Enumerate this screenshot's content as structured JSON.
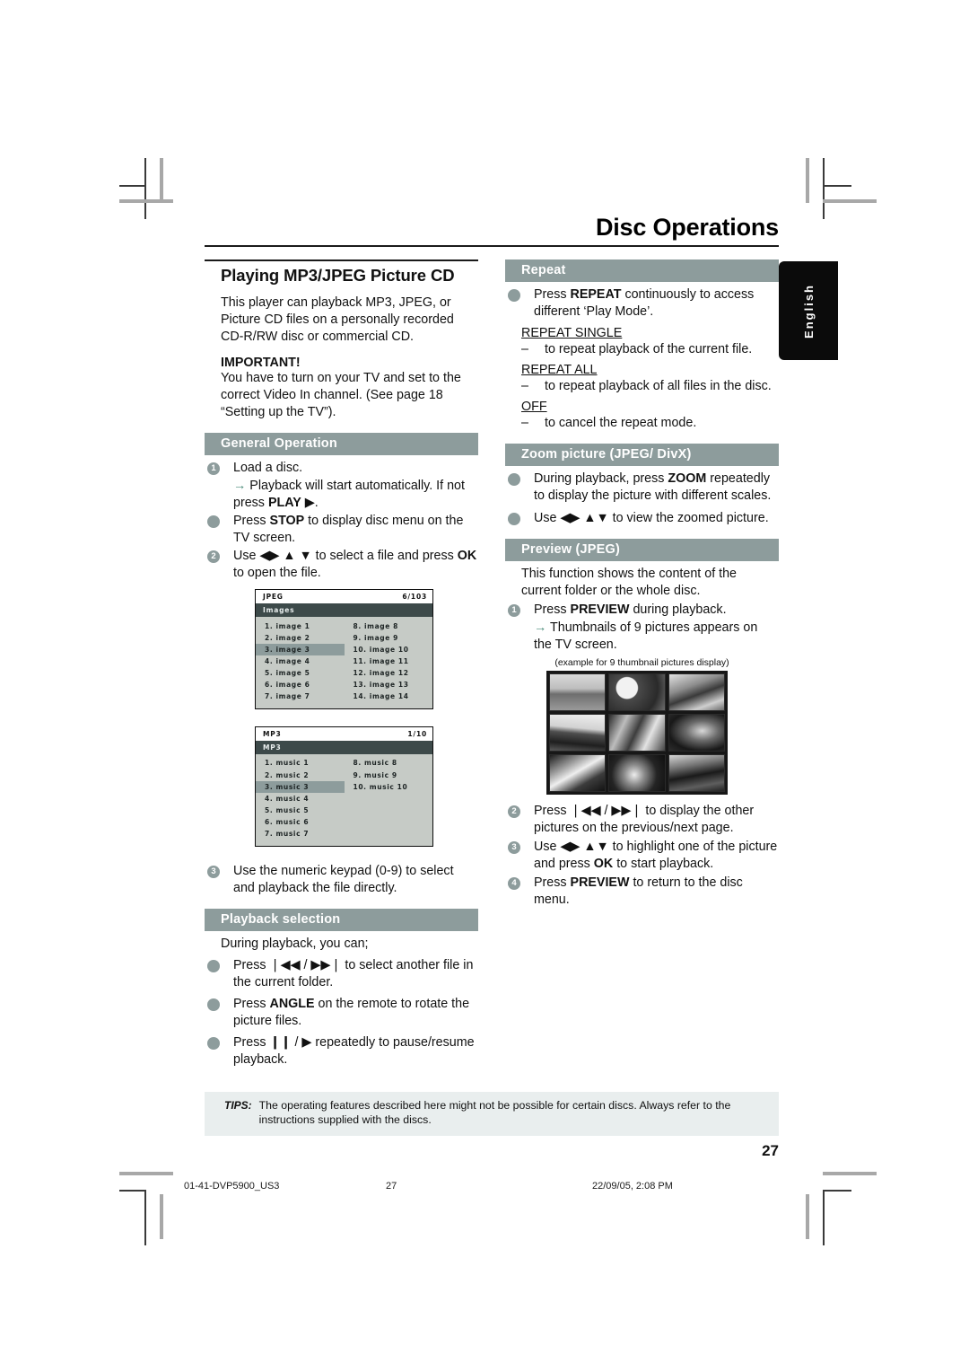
{
  "header": {
    "doc_title": "Disc Operations",
    "language_tab": "English"
  },
  "left_column": {
    "section_title": "Playing MP3/JPEG Picture CD",
    "intro": "This player can playback MP3, JPEG, or Picture CD files on a personally recorded CD-R/RW disc or commercial CD.",
    "important_label": "IMPORTANT!",
    "important_text": "You have to turn on your TV and set to the correct Video In channel.  (See page 18 “Setting up the TV”).",
    "general_operation": {
      "bar": "General Operation",
      "items": [
        {
          "marker": "1",
          "text": "Load a disc."
        },
        {
          "marker": "arrow",
          "text": "Playback will start automatically. If not press PLAY ▶."
        },
        {
          "marker": "dot",
          "text": "Press STOP to display disc menu on the TV screen."
        },
        {
          "marker": "2",
          "text": "Use ◀▶ ▲ ▼ to select a file and press OK to open the file."
        }
      ]
    },
    "jpeg_menu": {
      "type_label": "JPEG",
      "counter": "6/103",
      "folder": "Images",
      "col1": [
        "1. image 1",
        "2. image 2",
        "3. image 3",
        "4. image 4",
        "5. image 5",
        "6. image 6",
        "7. image 7"
      ],
      "col2": [
        "8. image 8",
        "9. image 9",
        "10. image 10",
        "11. image 11",
        "12. image 12",
        "13. image 13",
        "14. image 14"
      ],
      "highlighted": "3. image 3"
    },
    "mp3_menu": {
      "type_label": "MP3",
      "counter": "1/10",
      "folder": "MP3",
      "col1": [
        "1. music 1",
        "2. music 2",
        "3. music 3",
        "4. music 4",
        "5. music 5",
        "6. music 6",
        "7. music 7"
      ],
      "col2": [
        "8. music 8",
        "9. music 9",
        "10. music 10"
      ],
      "highlighted": "3. music 3"
    },
    "step3": {
      "marker": "3",
      "text": "Use the numeric keypad (0-9) to select and playback the file directly."
    },
    "playback_selection": {
      "bar": "Playback selection",
      "lead": "During playback, you can;",
      "items": [
        "Press ❘◀◀ / ▶▶❘ to select another file in the current folder.",
        "Press ANGLE on the remote to rotate the picture files.",
        "Press ❙❙ / ▶ repeatedly to pause/resume playback."
      ]
    }
  },
  "right_column": {
    "repeat": {
      "bar": "Repeat",
      "intro": "Press REPEAT continuously to access different ‘Play Mode’.",
      "modes": [
        {
          "name": "REPEAT SINGLE",
          "desc": "to repeat playback of the current file."
        },
        {
          "name": "REPEAT ALL",
          "desc": "to repeat playback of all files in the disc."
        },
        {
          "name": "OFF",
          "desc": "to cancel the repeat mode."
        }
      ]
    },
    "zoom_picture": {
      "bar": "Zoom picture (JPEG/ DivX)",
      "items": [
        "During playback, press ZOOM repeatedly to display the picture with different scales.",
        "Use ◀▶ ▲▼ to view the zoomed picture."
      ]
    },
    "preview": {
      "bar": "Preview (JPEG)",
      "intro": "This function shows the content of the current folder or the whole disc.",
      "step1": {
        "marker": "1",
        "text": "Press PREVIEW during playback."
      },
      "step1_arrow": "Thumbnails of 9 pictures appears on the TV screen.",
      "thumb_caption": "(example for 9 thumbnail pictures display)",
      "steps": [
        {
          "marker": "2",
          "text": "Press ❘◀◀ / ▶▶❘ to display the other pictures on the previous/next page."
        },
        {
          "marker": "3",
          "text": "Use ◀▶ ▲▼ to highlight one of the picture and press OK to start playback."
        },
        {
          "marker": "4",
          "text": "Press PREVIEW to return to the disc menu."
        }
      ]
    }
  },
  "tips": {
    "label": "TIPS:",
    "text": "The operating features described here might not be possible for certain discs.  Always refer to the instructions supplied with the discs."
  },
  "page_number": "27",
  "print_footer": {
    "file": "01-41-DVP5900_US3",
    "page": "27",
    "timestamp": "22/09/05, 2:08 PM"
  },
  "colors": {
    "section_bar": "#8d9c9c",
    "tips_bg": "#e9eeee",
    "osd_bg": "#c6cbc6",
    "osd_folder": "#3d4a4a",
    "arrow_green": "#4a8a78"
  }
}
